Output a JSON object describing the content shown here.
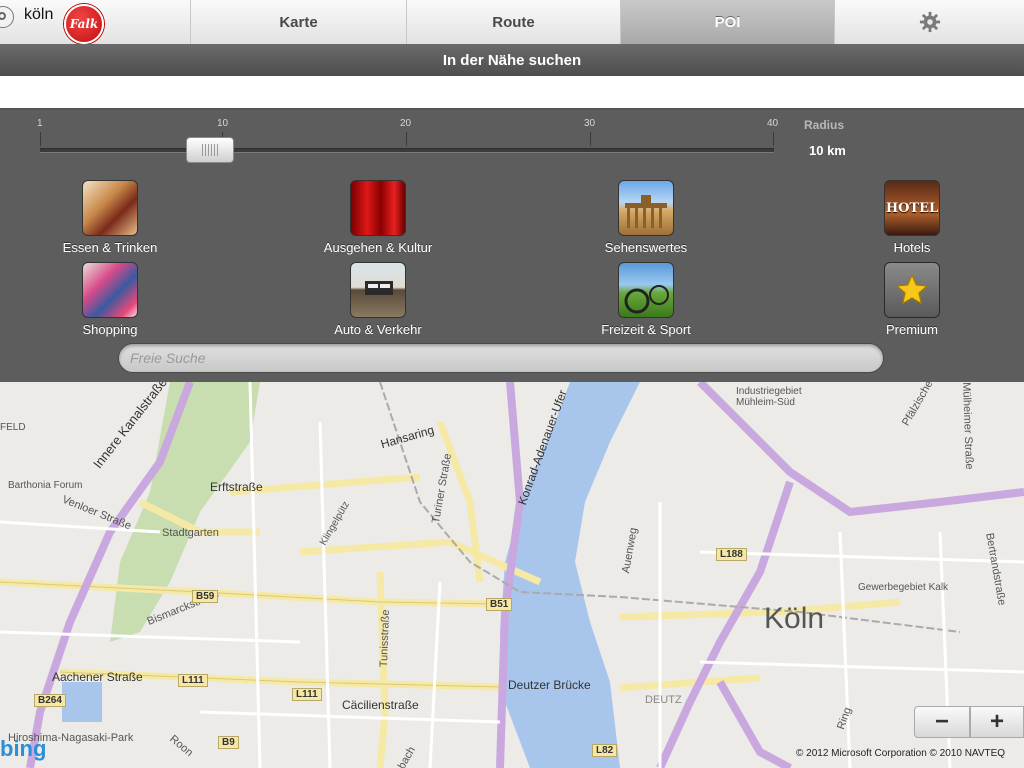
{
  "app": {
    "logo_text": "Falk",
    "tabs": [
      {
        "label": "Karte"
      },
      {
        "label": "Route"
      },
      {
        "label": "POI"
      }
    ],
    "settings_icon": "gear-icon"
  },
  "subtitle": "In der Nähe suchen",
  "search": {
    "value": "köln",
    "icon": "locate-icon"
  },
  "radius": {
    "label": "Radius",
    "value_text": "10 km",
    "ticks": [
      "1",
      "10",
      "20",
      "30",
      "40"
    ],
    "current": 10
  },
  "categories": [
    {
      "label": "Essen & Trinken",
      "icon": "food-icon"
    },
    {
      "label": "Ausgehen & Kultur",
      "icon": "theater-icon"
    },
    {
      "label": "Sehenswertes",
      "icon": "landmark-icon"
    },
    {
      "label": "Hotels",
      "icon": "hotel-icon",
      "badge": "HOTEL"
    },
    {
      "label": "Shopping",
      "icon": "shopping-icon"
    },
    {
      "label": "Auto & Verkehr",
      "icon": "car-icon"
    },
    {
      "label": "Freizeit & Sport",
      "icon": "bike-icon"
    },
    {
      "label": "Premium",
      "icon": "star-icon"
    }
  ],
  "free_search": {
    "placeholder": "Freie Suche"
  },
  "map": {
    "city": "Köln",
    "labels": {
      "innere_kanal": "Innere Kanalstraße",
      "erftstrasse": "Erftstraße",
      "hansaring": "Hansaring",
      "tunisstr_top": "Turiner Straße",
      "konrad": "Konrad-Adenauer-Ufer",
      "venloer": "Venloer Straße",
      "stadtgarten": "Stadtgarten",
      "bismarck": "Bismarckstraße",
      "klingelpuetz": "Klingelpütz",
      "tunisstrasse": "Tunisstraße",
      "aachener": "Aachener Straße",
      "caecilien": "Cäcilienstraße",
      "deutzer": "Deutzer Brücke",
      "hiroshima": "Hiroshima-Nagasaki-Park",
      "barthonia": "Barthonia Forum",
      "industrie": "Industriegebiet Mühleim-Süd",
      "gewerbe": "Gewerbegebiet Kalk",
      "deutz": "DEUTZ",
      "auenweg": "Auenweg",
      "pfaelzische": "Pfälzische",
      "bertrand": "Bertrandstraße",
      "muelheimer": "Mülheimer Straße",
      "feld": "FELD",
      "ring": "Ring",
      "roon": "Roon",
      "bach": "bach"
    },
    "shields": [
      "B59",
      "B51",
      "L188",
      "L111",
      "L111",
      "B264",
      "B9",
      "L82"
    ],
    "zoom_out": "−",
    "zoom_in": "+",
    "bing": "bing",
    "copyright": "© 2012 Microsoft Corporation    © 2010 NAVTEQ"
  },
  "colors": {
    "panel": "#5d5d5d",
    "river": "#a8c6ec",
    "major_road": "#c9a8e0",
    "road": "#f6e9a6",
    "park": "#c8deb0"
  }
}
